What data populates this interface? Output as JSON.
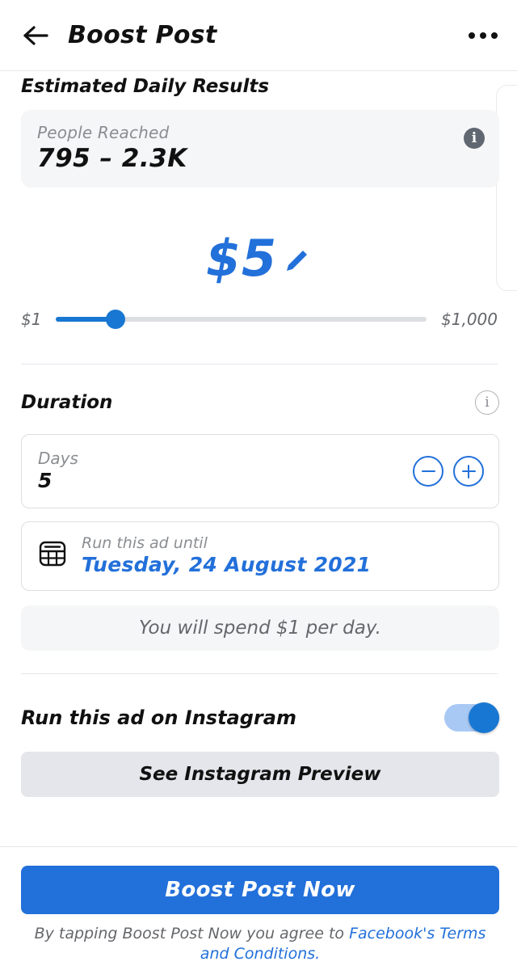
{
  "header": {
    "back_icon": "arrow-left-icon",
    "title": "Boost Post",
    "more_icon": "overflow-menu-icon"
  },
  "estimated_results": {
    "section_title": "Estimated Daily Results",
    "metric_label": "People Reached",
    "metric_value": "795 – 2.3K",
    "info_icon": "info-filled-icon"
  },
  "budget": {
    "amount": "$5",
    "edit_icon": "pencil-icon",
    "slider_min_label": "$1",
    "slider_max_label": "$1,000",
    "slider_percent": 16
  },
  "duration": {
    "section_title": "Duration",
    "info_icon": "info-outline-icon",
    "days_label": "Days",
    "days_value": "5",
    "decrease_label": "−",
    "increase_label": "+",
    "calendar_icon": "calendar-icon",
    "end_date_label": "Run this ad until",
    "end_date_value": "Tuesday, 24 August 2021",
    "spend_note": "You will spend $1 per day."
  },
  "instagram": {
    "label": "Run this ad on Instagram",
    "toggle_state": "on",
    "preview_button": "See Instagram Preview"
  },
  "footer": {
    "cta_label": "Boost Post Now",
    "terms_prefix": "By tapping Boost Post Now you agree to ",
    "terms_link": "Facebook's Terms and Conditions."
  },
  "colors": {
    "accent_blue": "#2270da",
    "slider_blue": "#1877d2",
    "toggle_track": "#a9c9f5",
    "muted_gray": "#8a8d91",
    "card_gray": "#f5f6f7"
  }
}
